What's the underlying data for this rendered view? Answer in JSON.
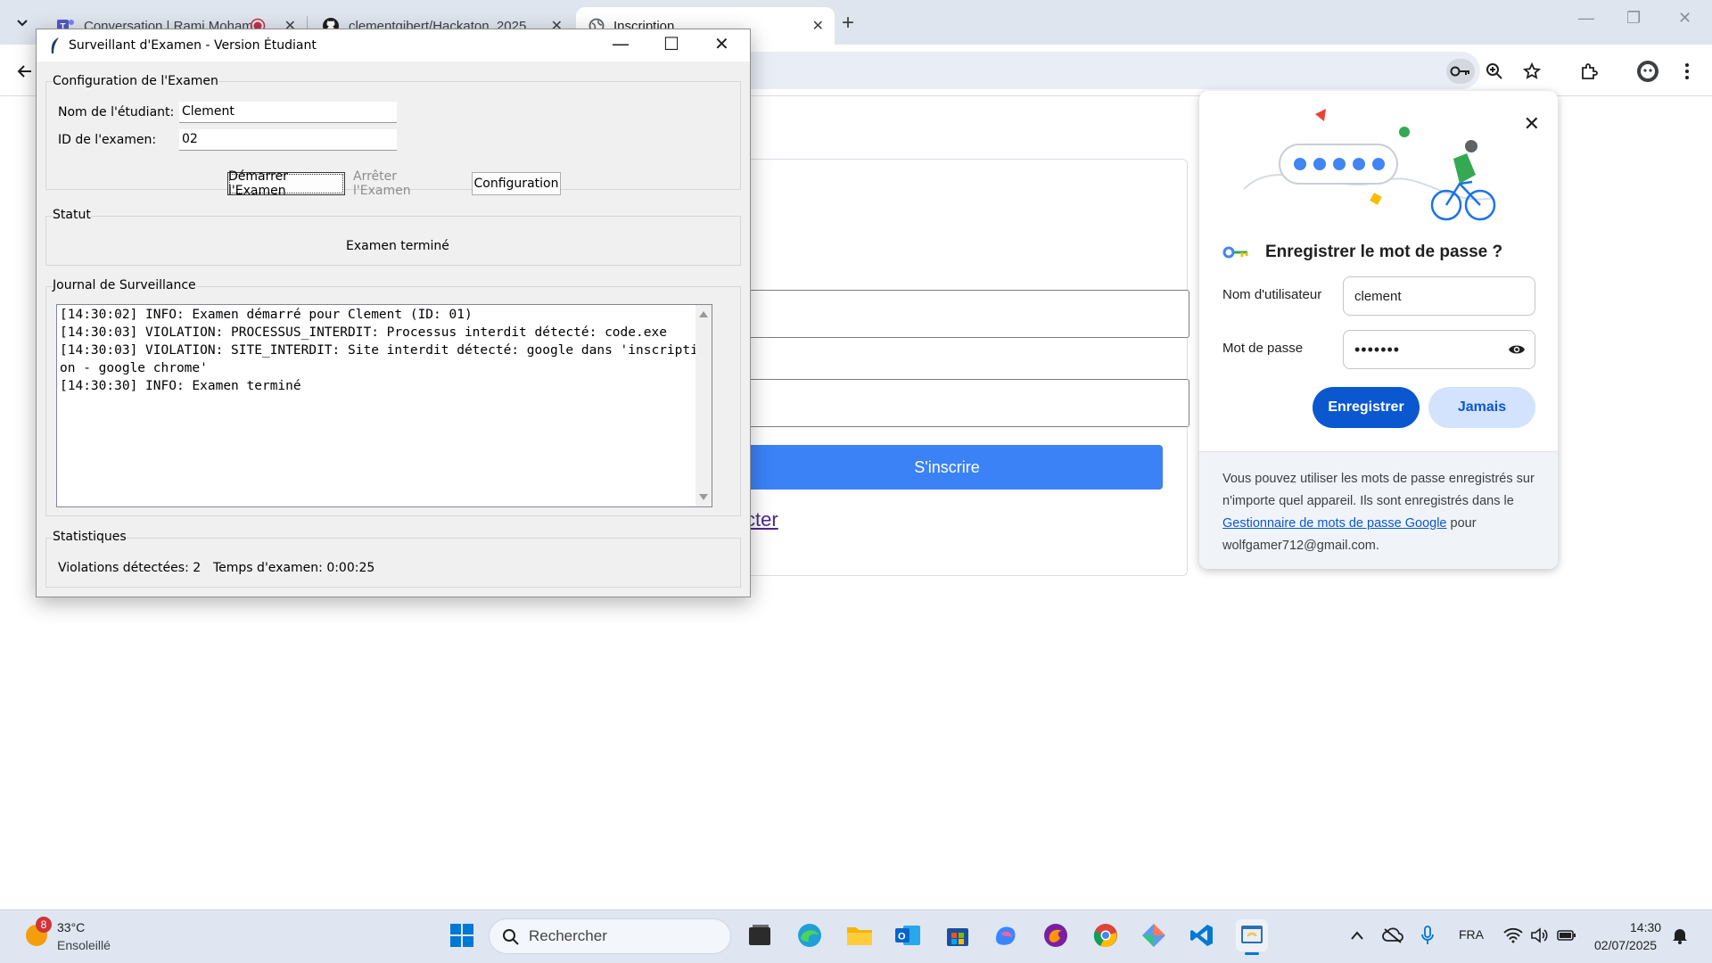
{
  "browser": {
    "tabs": [
      {
        "title": "Conversation | Rami Moham",
        "icon": "teams-icon"
      },
      {
        "title": "clementgibert/Hackaton_2025",
        "icon": "github-icon"
      },
      {
        "title": "Inscription",
        "icon": "globe-icon",
        "active": true
      }
    ],
    "close_glyph": "✕",
    "new_tab_glyph": "+",
    "window_controls": [
      "—",
      "❐",
      "✕"
    ]
  },
  "page": {
    "submit_label": "S'inscrire",
    "login_link": "cter"
  },
  "password_bubble": {
    "title": "Enregistrer le mot de passe ?",
    "username_label": "Nom d'utilisateur",
    "username_value": "clement",
    "password_label": "Mot de passe",
    "password_value": "•••••••",
    "save_label": "Enregistrer",
    "never_label": "Jamais",
    "footer_part1": "Vous pouvez utiliser les mots de passe enregistrés sur n'importe quel appareil. Ils sont enregistrés dans le ",
    "footer_link": "Gestionnaire de mots de passe Google",
    "footer_part2": " pour wolfgamer712@gmail.com.",
    "close_glyph": "✕"
  },
  "exam_app": {
    "window_title": "Surveillant d'Examen - Version Étudiant",
    "config_section": "Configuration de l'Examen",
    "student_label": "Nom de l'étudiant:",
    "student_value": "Clement",
    "exam_id_label": "ID de l'examen:",
    "exam_id_value": "02",
    "start_label": "Démarrer l'Examen",
    "stop_label": "Arrêter l'Examen",
    "configuration_label": "Configuration",
    "status_section": "Statut",
    "status_text": "Examen terminé",
    "log_section": "Journal de Surveillance",
    "log_lines": [
      "[14:30:02] INFO: Examen démarré pour Clement (ID: 01)",
      "[14:30:03] VIOLATION: PROCESSUS_INTERDIT: Processus interdit détecté: code.exe",
      "[14:30:03] VIOLATION: SITE_INTERDIT: Site interdit détecté: google dans 'inscription - google chrome'",
      "[14:30:30] INFO: Examen terminé"
    ],
    "stats_section": "Statistiques",
    "violations_text": "Violations détectées: 2",
    "time_text": "Temps d'examen: 0:00:25",
    "window_controls": [
      "—",
      "☐",
      "✕"
    ]
  },
  "taskbar": {
    "weather_temp": "33°C",
    "weather_desc": "Ensoleillé",
    "weather_badge": "8",
    "search_placeholder": "Rechercher",
    "language": "FRA",
    "time": "14:30",
    "date": "02/07/2025"
  },
  "colors": {
    "accent_blue": "#0b57d0",
    "submit_blue": "#3b82f6",
    "tab_bar": "#dfe5ee"
  }
}
